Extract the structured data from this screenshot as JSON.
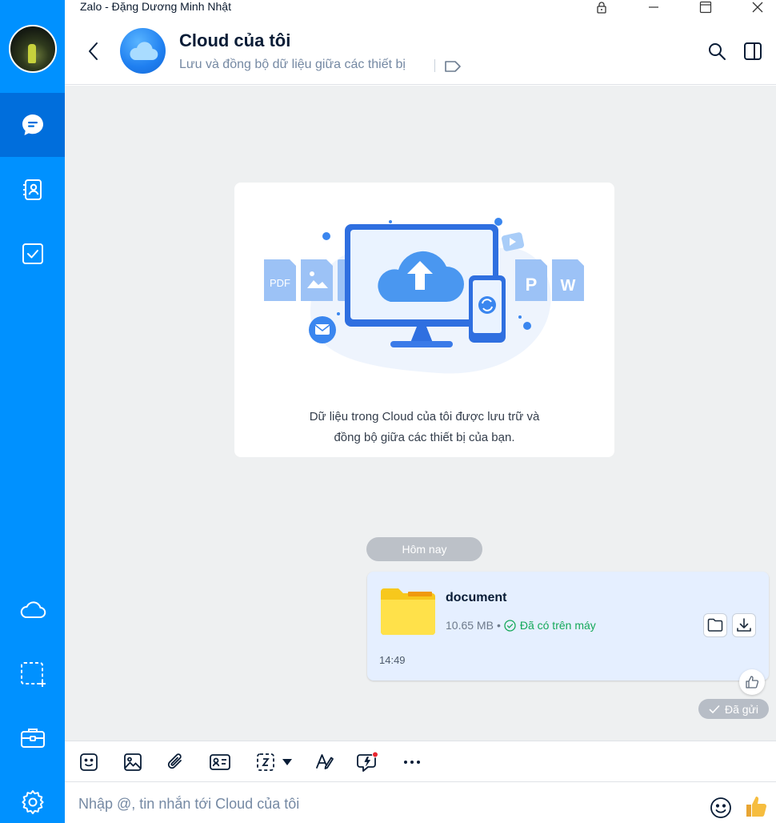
{
  "window": {
    "title": "Zalo - Đặng Dương Minh Nhật"
  },
  "sidebar": {
    "items": [
      {
        "name": "messages",
        "icon": "chat-bubble-icon",
        "active": true
      },
      {
        "name": "contacts",
        "icon": "contacts-icon"
      },
      {
        "name": "todo",
        "icon": "checkbox-icon"
      },
      {
        "name": "cloud",
        "icon": "cloud-icon"
      },
      {
        "name": "screenshot",
        "icon": "screenshot-icon"
      },
      {
        "name": "toolbox",
        "icon": "briefcase-icon"
      },
      {
        "name": "settings",
        "icon": "gear-icon"
      }
    ]
  },
  "header": {
    "title": "Cloud của tôi",
    "subtitle": "Lưu và đồng bộ dữ liệu giữa các thiết bị"
  },
  "intro": {
    "line1": "Dữ liệu trong Cloud của tôi được lưu trữ và",
    "line2": "đồng bộ giữa các thiết bị của bạn."
  },
  "chat": {
    "date_label": "Hôm nay",
    "message": {
      "file_name": "document",
      "file_size": "10.65 MB",
      "separator": "•",
      "status": "Đã có trên máy",
      "time": "14:49"
    },
    "sent_status": "Đã gửi"
  },
  "composer": {
    "placeholder": "Nhập @, tin nhắn tới Cloud của tôi"
  },
  "colors": {
    "sidebar": "#0091ff",
    "sidebar_active": "#006edc",
    "bubble": "#e5efff",
    "success": "#15a85a"
  }
}
